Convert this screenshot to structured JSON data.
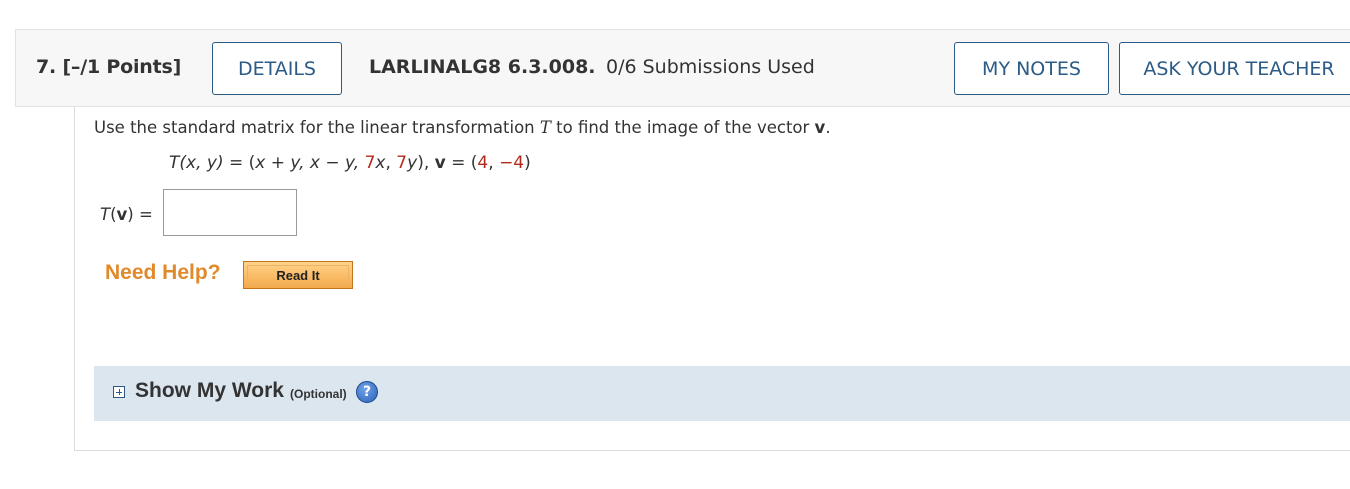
{
  "header": {
    "question_number": "7. [–/1 Points]",
    "details_label": "DETAILS",
    "question_code": "LARLINALG8 6.3.008.",
    "submissions": "0/6 Submissions Used",
    "my_notes_label": "MY NOTES",
    "ask_teacher_label": "ASK YOUR TEACHER"
  },
  "question": {
    "prompt_before": "Use the standard matrix for the linear transformation ",
    "prompt_T": "T",
    "prompt_after": " to find the image of the vector ",
    "prompt_v": "v",
    "prompt_end": ".",
    "formula": {
      "lhs": "T(x, y)",
      "equals": " = (",
      "part1": "x + y, x − y, ",
      "coef1": "7",
      "var1": "x",
      "sep": ", ",
      "coef2": "7",
      "var2": "y",
      "close": "), ",
      "v": "v",
      "v_equals": " = (",
      "v1": "4",
      "v_sep": ", ",
      "v2": "−4",
      "v_close": ")"
    },
    "answer_label_T": "T",
    "answer_label_v": "v",
    "answer_label_rest": " =",
    "answer_value": ""
  },
  "help": {
    "need_help": "Need Help?",
    "read_it": "Read It"
  },
  "show_my_work": {
    "title": "Show My Work",
    "optional": "(Optional)",
    "help_glyph": "?"
  },
  "colors": {
    "accent": "#2b5b86",
    "given_value_red": "#b32b1d",
    "need_help_orange": "#e08a2c",
    "panel_bg": "#dce6ef"
  }
}
